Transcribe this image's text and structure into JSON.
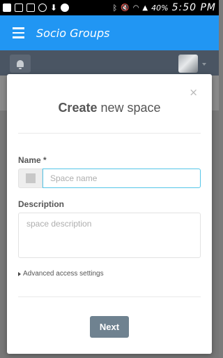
{
  "status_bar": {
    "left_icons": [
      "add-icon",
      "s-icon",
      "image-icon",
      "whatsapp-icon",
      "download-icon",
      "shield-icon"
    ],
    "right_icons": [
      "bluetooth-icon",
      "mute-icon",
      "wifi-icon",
      "signal-icon"
    ],
    "battery": "40%",
    "time": "5:50 PM"
  },
  "app_bar": {
    "title": "Socio Groups",
    "color": "#2196f3"
  },
  "modal": {
    "close_glyph": "×",
    "title_bold": "Create",
    "title_rest": "new space",
    "name_label": "Name *",
    "name_placeholder": "Space name",
    "name_value": "",
    "description_label": "Description",
    "description_placeholder": "space description",
    "description_value": "",
    "advanced_link": "Advanced access settings",
    "next_label": "Next",
    "next_color": "#6f8290",
    "input_focus_color": "#55c6e8"
  }
}
